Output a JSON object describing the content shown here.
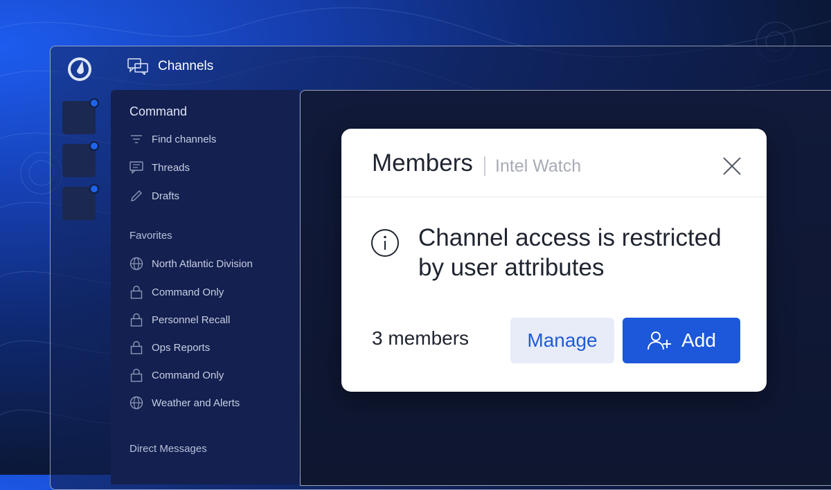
{
  "header": {
    "title": "Channels",
    "icon": "channels-icon"
  },
  "teams": [
    {
      "name": "team-1",
      "unread": true
    },
    {
      "name": "team-2",
      "unread": true
    },
    {
      "name": "team-3",
      "unread": true
    }
  ],
  "sidebar": {
    "team_name": "Command",
    "nav": [
      {
        "label": "Find channels",
        "icon": "filter-icon"
      },
      {
        "label": "Threads",
        "icon": "threads-icon"
      },
      {
        "label": "Drafts",
        "icon": "pencil-icon"
      }
    ],
    "favorites_header": "Favorites",
    "favorites": [
      {
        "label": "North Atlantic Division",
        "icon": "globe-icon"
      },
      {
        "label": "Command Only",
        "icon": "lock-icon"
      },
      {
        "label": "Personnel Recall",
        "icon": "lock-icon"
      },
      {
        "label": "Ops Reports",
        "icon": "lock-icon"
      },
      {
        "label": "Command Only",
        "icon": "lock-icon"
      },
      {
        "label": "Weather and Alerts",
        "icon": "globe-icon"
      }
    ],
    "dm_header": "Direct Messages"
  },
  "modal": {
    "title": "Members",
    "subtitle": "Intel Watch",
    "notice": "Channel access is restricted by user attributes",
    "member_count": "3 members",
    "manage_label": "Manage",
    "add_label": "Add"
  },
  "colors": {
    "accent": "#1c58d9",
    "unread_dot": "#1f63e6",
    "sidebar_bg": "#132050",
    "manage_bg": "#e8ecf8"
  }
}
